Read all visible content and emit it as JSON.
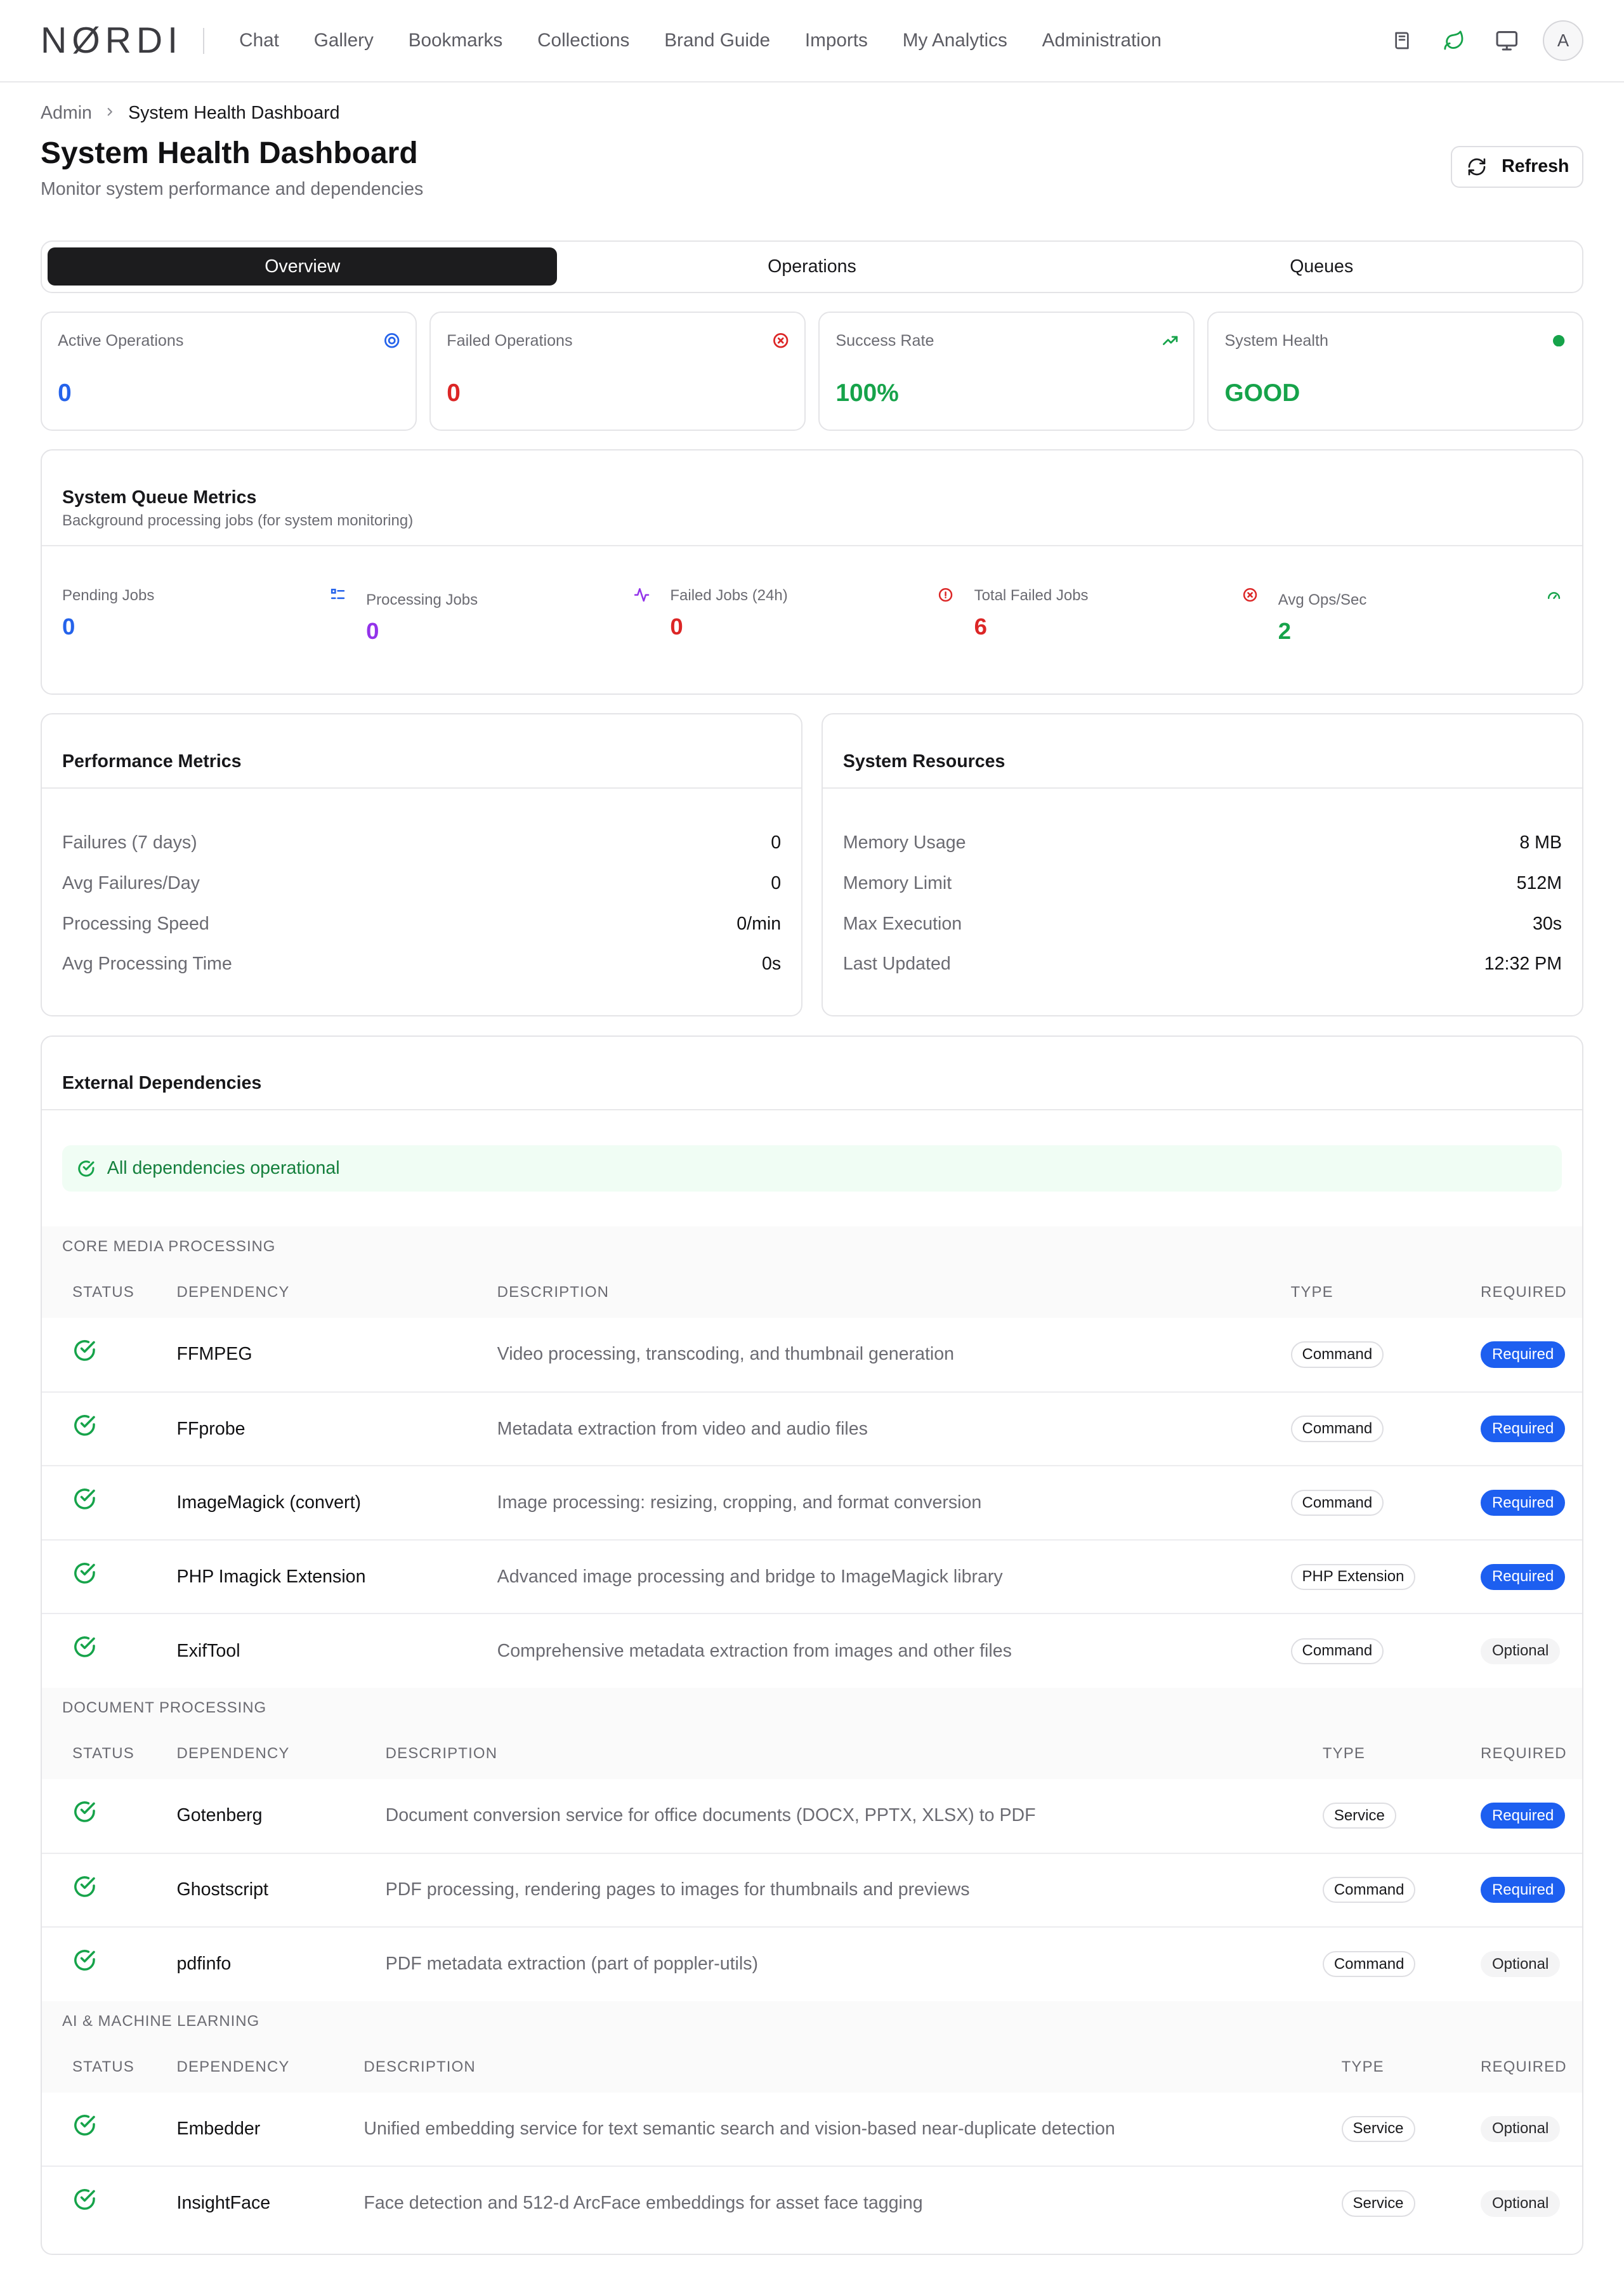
{
  "nav": {
    "logo": "NØRDI",
    "links": [
      "Chat",
      "Gallery",
      "Bookmarks",
      "Collections",
      "Brand Guide",
      "Imports",
      "My Analytics",
      "Administration"
    ],
    "avatar_initial": "A"
  },
  "breadcrumb": {
    "root": "Admin",
    "current": "System Health Dashboard"
  },
  "header": {
    "title": "System Health Dashboard",
    "subtitle": "Monitor system performance and dependencies",
    "refresh_label": "Refresh"
  },
  "tabs": [
    "Overview",
    "Operations",
    "Queues"
  ],
  "active_tab": "Overview",
  "stats": [
    {
      "label": "Active Operations",
      "value": "0",
      "icon": "target-icon",
      "color": "#2563eb"
    },
    {
      "label": "Failed Operations",
      "value": "0",
      "icon": "x-circle-icon",
      "color": "#dc2626"
    },
    {
      "label": "Success Rate",
      "value": "100%",
      "icon": "trending-up-icon",
      "color": "#16a34a"
    },
    {
      "label": "System Health",
      "value": "GOOD",
      "icon": "status-dot-icon",
      "color": "#16a34a"
    }
  ],
  "queue": {
    "title": "System Queue Metrics",
    "description": "Background processing jobs (for system monitoring)",
    "items": [
      {
        "label": "Pending Jobs",
        "value": "0",
        "icon": "list-icon",
        "color": "#2563eb"
      },
      {
        "label": "Processing Jobs",
        "value": "0",
        "icon": "activity-icon",
        "color": "#9333ea"
      },
      {
        "label": "Failed Jobs (24h)",
        "value": "0",
        "icon": "alert-circle-icon",
        "color": "#dc2626"
      },
      {
        "label": "Total Failed Jobs",
        "value": "6",
        "icon": "x-circle-icon",
        "color": "#dc2626"
      },
      {
        "label": "Avg Ops/Sec",
        "value": "2",
        "icon": "gauge-icon",
        "color": "#16a34a"
      }
    ]
  },
  "performance": {
    "title": "Performance Metrics",
    "rows": [
      {
        "key": "Failures (7 days)",
        "value": "0"
      },
      {
        "key": "Avg Failures/Day",
        "value": "0"
      },
      {
        "key": "Processing Speed",
        "value": "0/min"
      },
      {
        "key": "Avg Processing Time",
        "value": "0s"
      }
    ]
  },
  "resources": {
    "title": "System Resources",
    "rows": [
      {
        "key": "Memory Usage",
        "value": "8 MB"
      },
      {
        "key": "Memory Limit",
        "value": "512M"
      },
      {
        "key": "Max Execution",
        "value": "30s"
      },
      {
        "key": "Last Updated",
        "value": "12:32 PM"
      }
    ]
  },
  "dependencies": {
    "title": "External Dependencies",
    "status_message": "All dependencies operational",
    "columns": {
      "status": "STATUS",
      "dependency": "DEPENDENCY",
      "description": "DESCRIPTION",
      "type": "TYPE",
      "required": "REQUIRED"
    },
    "sections": [
      {
        "label": "CORE MEDIA PROCESSING",
        "rows": [
          {
            "name": "FFMPEG",
            "description": "Video processing, transcoding, and thumbnail generation",
            "type": "Command",
            "required": "Required"
          },
          {
            "name": "FFprobe",
            "description": "Metadata extraction from video and audio files",
            "type": "Command",
            "required": "Required"
          },
          {
            "name": "ImageMagick (convert)",
            "description": "Image processing: resizing, cropping, and format conversion",
            "type": "Command",
            "required": "Required"
          },
          {
            "name": "PHP Imagick Extension",
            "description": "Advanced image processing and bridge to ImageMagick library",
            "type": "PHP Extension",
            "required": "Required"
          },
          {
            "name": "ExifTool",
            "description": "Comprehensive metadata extraction from images and other files",
            "type": "Command",
            "required": "Optional"
          }
        ]
      },
      {
        "label": "DOCUMENT PROCESSING",
        "rows": [
          {
            "name": "Gotenberg",
            "description": "Document conversion service for office documents (DOCX, PPTX, XLSX) to PDF",
            "type": "Service",
            "required": "Required"
          },
          {
            "name": "Ghostscript",
            "description": "PDF processing, rendering pages to images for thumbnails and previews",
            "type": "Command",
            "required": "Required"
          },
          {
            "name": "pdfinfo",
            "description": "PDF metadata extraction (part of poppler-utils)",
            "type": "Command",
            "required": "Optional"
          }
        ]
      },
      {
        "label": "AI & MACHINE LEARNING",
        "rows": [
          {
            "name": "Embedder",
            "description": "Unified embedding service for text semantic search and vision-based near-duplicate detection",
            "type": "Service",
            "required": "Optional"
          },
          {
            "name": "InsightFace",
            "description": "Face detection and 512-d ArcFace embeddings for asset face tagging",
            "type": "Service",
            "required": "Optional"
          }
        ]
      }
    ]
  }
}
